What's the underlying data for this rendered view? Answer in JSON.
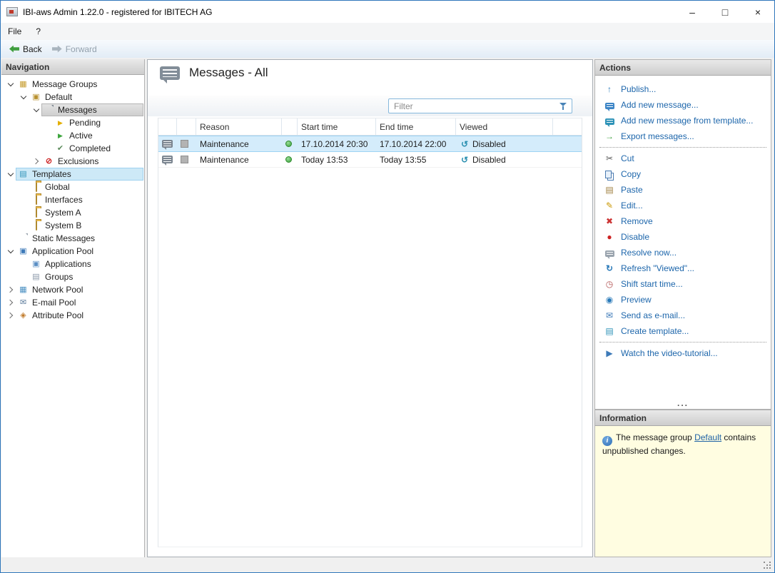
{
  "window": {
    "title": "IBI-aws Admin 1.22.0 - registered for IBITECH AG",
    "controls": {
      "minimize": "–",
      "maximize": "□",
      "close": "×"
    }
  },
  "menubar": {
    "items": [
      {
        "label": "File"
      },
      {
        "label": "?"
      }
    ]
  },
  "toolbar": {
    "back_label": "Back",
    "forward_label": "Forward"
  },
  "navigation": {
    "header": "Navigation",
    "tree": [
      {
        "label": "Message Groups",
        "level": 0,
        "state": "expanded",
        "icon": "message-groups-icon"
      },
      {
        "label": "Default",
        "level": 1,
        "state": "expanded",
        "icon": "message-group-icon"
      },
      {
        "label": "Messages",
        "level": 2,
        "state": "expanded",
        "icon": "messages-icon",
        "selected": true
      },
      {
        "label": "Pending",
        "level": 3,
        "state": "leaf",
        "icon": "pending-icon"
      },
      {
        "label": "Active",
        "level": 3,
        "state": "leaf",
        "icon": "active-icon"
      },
      {
        "label": "Completed",
        "level": 3,
        "state": "leaf",
        "icon": "completed-icon"
      },
      {
        "label": "Exclusions",
        "level": 2,
        "state": "collapsed",
        "icon": "exclusions-icon"
      },
      {
        "label": "Templates",
        "level": 0,
        "state": "expanded",
        "icon": "templates-icon",
        "highlighted": true
      },
      {
        "label": "Global",
        "level": 1,
        "state": "leaf",
        "icon": "folder-icon"
      },
      {
        "label": "Interfaces",
        "level": 1,
        "state": "leaf",
        "icon": "folder-icon"
      },
      {
        "label": "System A",
        "level": 1,
        "state": "leaf",
        "icon": "folder-icon"
      },
      {
        "label": "System B",
        "level": 1,
        "state": "leaf",
        "icon": "folder-icon"
      },
      {
        "label": "Static Messages",
        "level": 0,
        "state": "leaf",
        "icon": "static-messages-icon"
      },
      {
        "label": "Application Pool",
        "level": 0,
        "state": "expanded",
        "icon": "application-pool-icon"
      },
      {
        "label": "Applications",
        "level": 1,
        "state": "leaf",
        "icon": "applications-icon"
      },
      {
        "label": "Groups",
        "level": 1,
        "state": "leaf",
        "icon": "groups-icon"
      },
      {
        "label": "Network Pool",
        "level": 0,
        "state": "collapsed",
        "icon": "network-pool-icon"
      },
      {
        "label": "E-mail Pool",
        "level": 0,
        "state": "collapsed",
        "icon": "email-pool-icon"
      },
      {
        "label": "Attribute Pool",
        "level": 0,
        "state": "collapsed",
        "icon": "attribute-pool-icon"
      }
    ]
  },
  "main": {
    "title": "Messages - All",
    "filter": {
      "placeholder": "Filter"
    },
    "table": {
      "columns": {
        "reason": "Reason",
        "start": "Start time",
        "end": "End time",
        "viewed": "Viewed"
      },
      "rows": [
        {
          "reason": "Maintenance",
          "status": "active",
          "start": "17.10.2014 20:30",
          "end": "17.10.2014 22:00",
          "viewed": "Disabled",
          "selected": true
        },
        {
          "reason": "Maintenance",
          "status": "active",
          "start": "Today 13:53",
          "end": "Today 13:55",
          "viewed": "Disabled",
          "selected": false
        }
      ]
    }
  },
  "actions": {
    "header": "Actions",
    "items": [
      {
        "label": "Publish...",
        "icon": "publish-icon"
      },
      {
        "label": "Add new message...",
        "icon": "add-message-icon"
      },
      {
        "label": "Add new message from template...",
        "icon": "add-message-from-template-icon"
      },
      {
        "label": "Export messages...",
        "icon": "export-messages-icon"
      },
      {
        "separator": true
      },
      {
        "label": "Cut",
        "icon": "cut-icon"
      },
      {
        "label": "Copy",
        "icon": "copy-icon"
      },
      {
        "label": "Paste",
        "icon": "paste-icon"
      },
      {
        "label": "Edit...",
        "icon": "edit-icon"
      },
      {
        "label": "Remove",
        "icon": "remove-icon"
      },
      {
        "label": "Disable",
        "icon": "disable-icon"
      },
      {
        "label": "Resolve now...",
        "icon": "resolve-icon"
      },
      {
        "label": "Refresh \"Viewed\"...",
        "icon": "refresh-viewed-icon"
      },
      {
        "label": "Shift start time...",
        "icon": "shift-start-time-icon"
      },
      {
        "label": "Preview",
        "icon": "preview-icon"
      },
      {
        "label": "Send as e-mail...",
        "icon": "send-email-icon"
      },
      {
        "label": "Create template...",
        "icon": "create-template-icon"
      },
      {
        "separator": true
      },
      {
        "label": "Watch the video-tutorial...",
        "icon": "video-tutorial-icon"
      }
    ],
    "overflow_indicator": "..."
  },
  "information": {
    "header": "Information",
    "text_before": "The message group ",
    "link_label": "Default",
    "text_after": " contains unpublished changes."
  }
}
